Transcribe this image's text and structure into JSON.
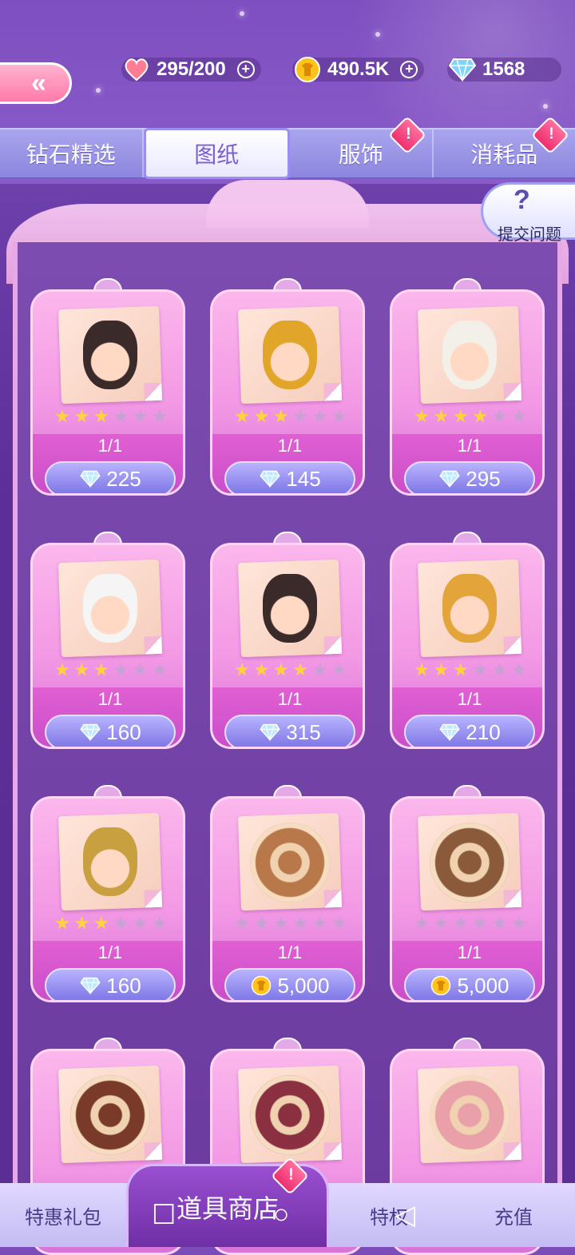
{
  "resources": {
    "hearts": "295/200",
    "gold": "490.5K",
    "diamonds": "1568"
  },
  "tabs": [
    {
      "label": "钻石精选",
      "alert": false
    },
    {
      "label": "图纸",
      "alert": false
    },
    {
      "label": "服饰",
      "alert": true
    },
    {
      "label": "消耗品",
      "alert": true
    }
  ],
  "active_tab": "图纸",
  "help": {
    "label": "提交问题",
    "symbol": "?"
  },
  "items": [
    {
      "art": "hairstyle-bun-icon",
      "stars": 3,
      "qty": "1/1",
      "currency": "diamond",
      "price": "225"
    },
    {
      "art": "ruby-ring-icon",
      "stars": 3,
      "qty": "1/1",
      "currency": "diamond",
      "price": "145"
    },
    {
      "art": "white-boots-icon",
      "stars": 4,
      "qty": "1/1",
      "currency": "diamond",
      "price": "295"
    },
    {
      "art": "flower-earrings-icon",
      "stars": 3,
      "qty": "1/1",
      "currency": "diamond",
      "price": "160"
    },
    {
      "art": "hairstyle-pin-icon",
      "stars": 4,
      "qty": "1/1",
      "currency": "diamond",
      "price": "315"
    },
    {
      "art": "gold-shoes-icon",
      "stars": 3,
      "qty": "1/1",
      "currency": "diamond",
      "price": "210"
    },
    {
      "art": "necklace-icon",
      "stars": 3,
      "qty": "1/1",
      "currency": "diamond",
      "price": "160"
    },
    {
      "art": "pattern-medallion-icon",
      "stars": 0,
      "qty": "1/1",
      "currency": "gold",
      "price": "5,000"
    },
    {
      "art": "paisley-pattern-icon",
      "stars": 0,
      "qty": "1/1",
      "currency": "gold",
      "price": "5,000"
    },
    {
      "art": "lace-pattern-icon",
      "stars": 0,
      "qty": "",
      "currency": "",
      "price": ""
    },
    {
      "art": "mandala-pattern-icon",
      "stars": 0,
      "qty": "",
      "currency": "",
      "price": ""
    },
    {
      "art": "blossom-pattern-icon",
      "stars": 0,
      "qty": "",
      "currency": "",
      "price": ""
    }
  ],
  "bottom_nav": [
    {
      "label": "特惠礼包"
    },
    {
      "label": "道具商店",
      "active": true
    },
    {
      "label": "特权"
    },
    {
      "label": "充值"
    }
  ],
  "colors": {
    "accent": "#f399e5",
    "price_button": "#8f87ea",
    "star": "#ffd23f"
  }
}
